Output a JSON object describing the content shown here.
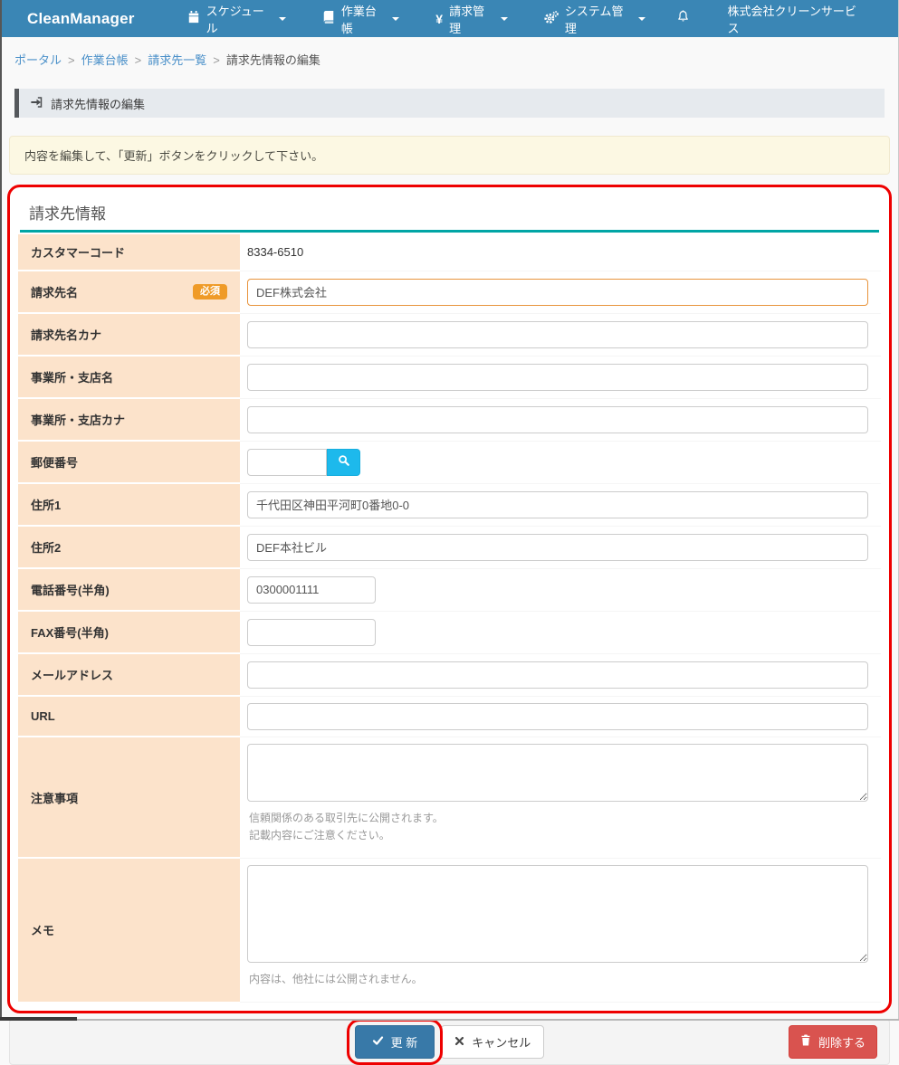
{
  "navbar": {
    "brand": "CleanManager",
    "items": [
      {
        "label": "スケジュール",
        "icon": "calendar-icon"
      },
      {
        "label": "作業台帳",
        "icon": "book-icon"
      },
      {
        "label": "請求管理",
        "icon": "yen-icon",
        "icon_text": "¥"
      },
      {
        "label": "システム管理",
        "icon": "gears-icon"
      }
    ],
    "company": "株式会社クリーンサービス"
  },
  "breadcrumb": {
    "separator": ">",
    "links": [
      "ポータル",
      "作業台帳",
      "請求先一覧"
    ],
    "current": "請求先情報の編集"
  },
  "page_header": {
    "title": "請求先情報の編集"
  },
  "alert": {
    "message": "内容を編集して、「更新」ボタンをクリックして下さい。"
  },
  "form": {
    "section_title": "請求先情報",
    "required_badge": "必須",
    "fields": {
      "customer_code": {
        "label": "カスタマーコード",
        "value": "8334-6510"
      },
      "billing_name": {
        "label": "請求先名",
        "value": "DEF株式会社"
      },
      "billing_name_kana": {
        "label": "請求先名カナ",
        "value": ""
      },
      "office_name": {
        "label": "事業所・支店名",
        "value": ""
      },
      "office_name_kana": {
        "label": "事業所・支店カナ",
        "value": ""
      },
      "postal_code": {
        "label": "郵便番号",
        "value": ""
      },
      "address1": {
        "label": "住所1",
        "value": "千代田区神田平河町0番地0-0"
      },
      "address2": {
        "label": "住所2",
        "value": "DEF本社ビル"
      },
      "phone": {
        "label": "電話番号(半角)",
        "value": "0300001111"
      },
      "fax": {
        "label": "FAX番号(半角)",
        "value": ""
      },
      "email": {
        "label": "メールアドレス",
        "value": ""
      },
      "url": {
        "label": "URL",
        "value": ""
      },
      "notes": {
        "label": "注意事項",
        "value": "",
        "hint_line1": "信頼関係のある取引先に公開されます。",
        "hint_line2": "記載内容にご注意ください。"
      },
      "memo": {
        "label": "メモ",
        "value": "",
        "hint": "内容は、他社には公開されません。"
      }
    }
  },
  "footer": {
    "update_label": "更 新",
    "cancel_label": "キャンセル",
    "delete_label": "削除する"
  },
  "colors": {
    "navbar_blue": "#3a86b5",
    "accent_teal": "#00a5a5",
    "label_bg": "#fce3cb",
    "required_badge_orange": "#ef9b28",
    "primary_button_blue": "#3879a8",
    "delete_button_red": "#d9534f",
    "search_button_cyan": "#1db9ec",
    "annotation_red": "#ee0000",
    "alert_bg": "#fcf8e3"
  }
}
